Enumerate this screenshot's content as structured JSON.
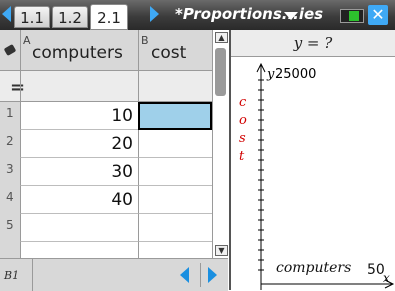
{
  "tabs": [
    {
      "label": "1.1",
      "active": false
    },
    {
      "label": "1.2",
      "active": false
    },
    {
      "label": "2.1",
      "active": true
    }
  ],
  "document_title": "*Proportions...ies",
  "spreadsheet": {
    "columns": [
      {
        "letter": "A",
        "name": "computers"
      },
      {
        "letter": "B",
        "name": "cost"
      }
    ],
    "formula_row_symbol": "=",
    "rows": [
      {
        "num": "1",
        "a": "10",
        "b": ""
      },
      {
        "num": "2",
        "a": "20",
        "b": ""
      },
      {
        "num": "3",
        "a": "30",
        "b": ""
      },
      {
        "num": "4",
        "a": "40",
        "b": ""
      },
      {
        "num": "5",
        "a": "",
        "b": ""
      }
    ],
    "selected_cell": "B1",
    "status_cell_ref": "B1"
  },
  "graph": {
    "header": "y = ?",
    "y_axis_letter": "y",
    "y_max_label": "25000",
    "y_axis_title": "cost",
    "x_axis_title": "computers",
    "x_max_label": "50",
    "x_axis_letter": "x",
    "colors": {
      "y_title": "#d10000",
      "axis": "#000000"
    }
  },
  "colors": {
    "accent": "#3fa9f5",
    "selected_cell": "#9fd0ea"
  }
}
